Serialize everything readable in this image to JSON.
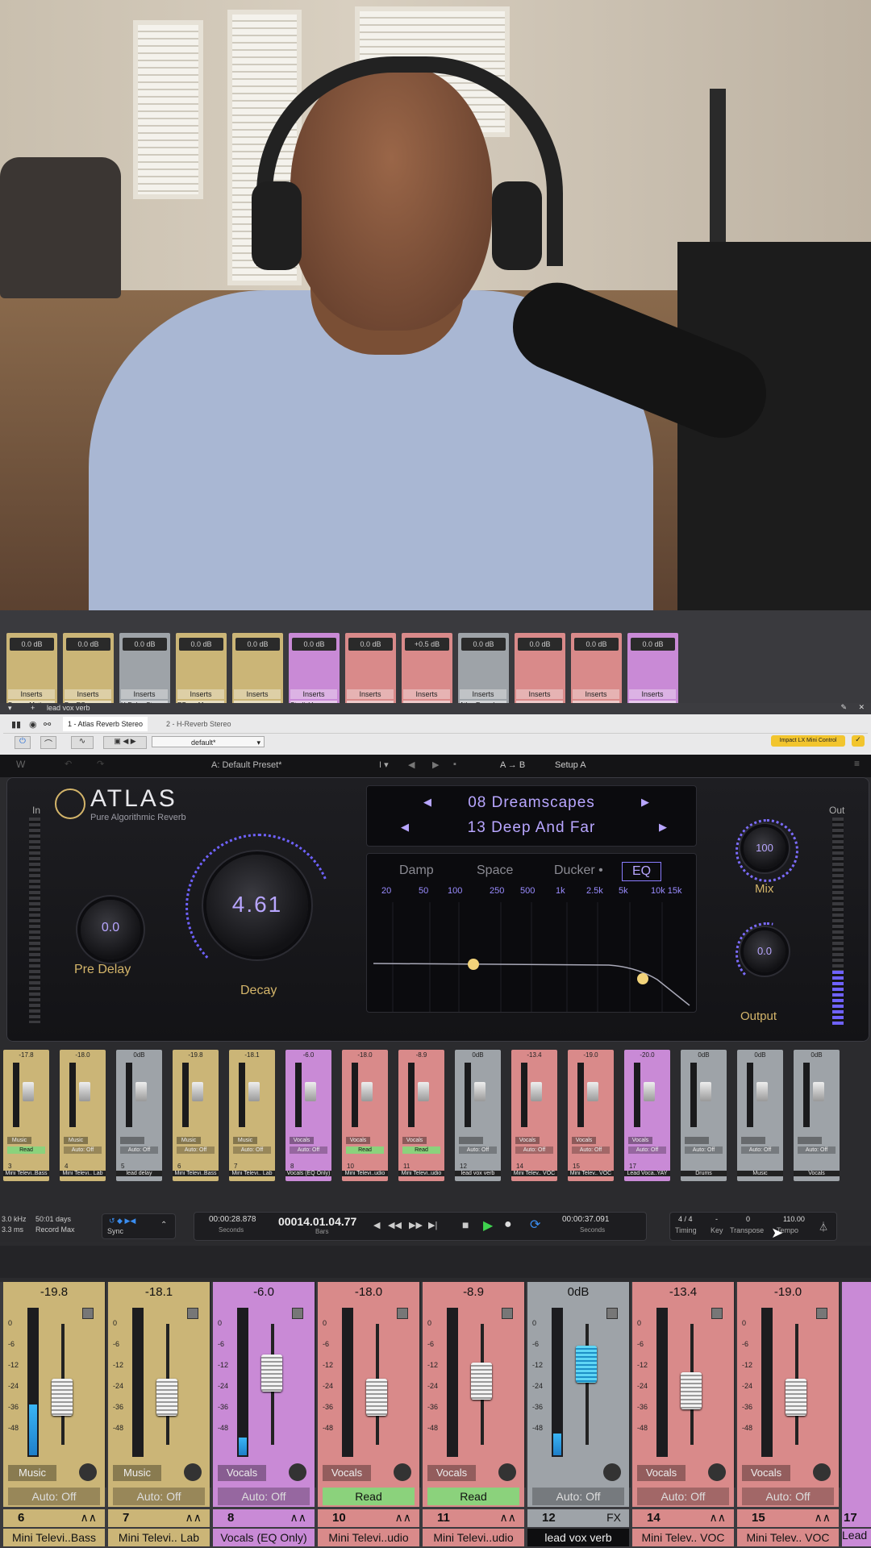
{
  "colors": {
    "music": "#cbb577",
    "vocals": "#c98ad6",
    "mini": "#d98a8a",
    "gray": "#9ea3a8",
    "accent": "#8a7cff"
  },
  "top_channels": [
    {
      "db": "0.0 dB",
      "ins": "Inserts",
      "plugin": "Brauer Moti..",
      "color": "#cbb577"
    },
    {
      "db": "0.0 dB",
      "ins": "Inserts",
      "plugin": "Pro EQ",
      "color": "#cbb577"
    },
    {
      "db": "0.0 dB",
      "ins": "Inserts",
      "plugin": "H-Delay Ster..",
      "color": "#9ea3a8"
    },
    {
      "db": "0.0 dB",
      "ins": "Inserts",
      "plugin": "RBass Mono",
      "color": "#cbb577"
    },
    {
      "db": "0.0 dB",
      "ins": "Inserts",
      "plugin": "",
      "color": "#cbb577"
    },
    {
      "db": "0.0 dB",
      "ins": "Inserts",
      "plugin": "StudioVerse..",
      "color": "#c98ad6"
    },
    {
      "db": "0.0 dB",
      "ins": "Inserts",
      "plugin": "",
      "color": "#d98a8a"
    },
    {
      "db": "+0.5 dB",
      "ins": "Inserts",
      "plugin": "",
      "color": "#d98a8a"
    },
    {
      "db": "0.0 dB",
      "ins": "Inserts",
      "plugin": "Atlas Reverb",
      "color": "#9ea3a8"
    },
    {
      "db": "0.0 dB",
      "ins": "Inserts",
      "plugin": "",
      "color": "#d98a8a"
    },
    {
      "db": "0.0 dB",
      "ins": "Inserts",
      "plugin": "",
      "color": "#d98a8a"
    },
    {
      "db": "0.0 dB",
      "ins": "Inserts",
      "plugin": "",
      "color": "#c98ad6"
    }
  ],
  "plugin_window": {
    "track": "lead vox verb",
    "slot1": "1 - Atlas Reverb Stereo",
    "slot2": "2 - H-Reverb Stereo",
    "preset_dropdown": "default*",
    "controller": "Impact LX Mini Control",
    "preset_name": "A: Default Preset*",
    "ab": "A → B",
    "setup": "Setup A"
  },
  "atlas": {
    "brand": "ATLAS",
    "subtitle": "Pure Algorithmic Reverb",
    "in_label": "In",
    "out_label": "Out",
    "category": "08 Dreamscapes",
    "preset": "13 Deep And Far",
    "tabs": [
      "Damp",
      "Space",
      "Ducker •",
      "EQ"
    ],
    "freqs": [
      "20",
      "50",
      "100",
      "250",
      "500",
      "1k",
      "2.5k",
      "5k",
      "10k 15k"
    ],
    "pre_delay_value": "0.0",
    "pre_delay_label": "Pre Delay",
    "decay_value": "4.61",
    "decay_label": "Decay",
    "mix_value": "100",
    "mix_label": "Mix",
    "output_value": "0.0",
    "output_label": "Output"
  },
  "small_mixer": [
    {
      "v": "-17.8",
      "tag": "Music",
      "auto": "Read",
      "num": "3",
      "name": "Mini Televi..Bass",
      "color": "#cbb577"
    },
    {
      "v": "-18.0",
      "tag": "Music",
      "auto": "Auto: Off",
      "num": "4",
      "name": "Mini Televi.. Lab",
      "color": "#cbb577"
    },
    {
      "v": "0dB",
      "tag": "",
      "auto": "Auto: Off",
      "num": "5",
      "name": "lead delay",
      "color": "#9ea3a8"
    },
    {
      "v": "-19.8",
      "tag": "Music",
      "auto": "Auto: Off",
      "num": "6",
      "name": "Mini Televi..Bass",
      "color": "#cbb577"
    },
    {
      "v": "-18.1",
      "tag": "Music",
      "auto": "Auto: Off",
      "num": "7",
      "name": "Mini Televi.. Lab",
      "color": "#cbb577"
    },
    {
      "v": "-6.0",
      "tag": "Vocals",
      "auto": "Auto: Off",
      "num": "8",
      "name": "Vocals (EQ Only)",
      "color": "#c98ad6"
    },
    {
      "v": "-18.0",
      "tag": "Vocals",
      "auto": "Read",
      "num": "10",
      "name": "Mini Televi..udio",
      "color": "#d98a8a"
    },
    {
      "v": "-8.9",
      "tag": "Vocals",
      "auto": "Read",
      "num": "11",
      "name": "Mini Televi..udio",
      "color": "#d98a8a"
    },
    {
      "v": "0dB",
      "tag": "",
      "auto": "Auto: Off",
      "num": "12",
      "name": "lead vox verb",
      "color": "#9ea3a8"
    },
    {
      "v": "-13.4",
      "tag": "Vocals",
      "auto": "Auto: Off",
      "num": "14",
      "name": "Mini Telev.. VOC",
      "color": "#d98a8a"
    },
    {
      "v": "-19.0",
      "tag": "Vocals",
      "auto": "Auto: Off",
      "num": "15",
      "name": "Mini Telev.. VOC",
      "color": "#d98a8a"
    },
    {
      "v": "-20.0",
      "tag": "Vocals",
      "auto": "Auto: Off",
      "num": "17",
      "name": "Lead Voca..YAY",
      "color": "#c98ad6"
    },
    {
      "v": "0dB",
      "tag": "",
      "auto": "Auto: Off",
      "num": "",
      "name": "Drums",
      "color": "#9ea3a8"
    },
    {
      "v": "0dB",
      "tag": "",
      "auto": "Auto: Off",
      "num": "",
      "name": "Music",
      "color": "#9ea3a8"
    },
    {
      "v": "0dB",
      "tag": "",
      "auto": "Auto: Off",
      "num": "",
      "name": "Vocals",
      "color": "#9ea3a8"
    }
  ],
  "transport": {
    "sample_rate": "3.0 kHz",
    "latency": "3.3 ms",
    "record_days": "50:01 days",
    "record_max": "Record Max",
    "sync": "Sync",
    "time1": "00:00:28.878",
    "time1_unit": "Seconds",
    "bars": "00014.01.04.77",
    "bars_unit": "Bars",
    "time2": "00:00:37.091",
    "time2_unit": "Seconds",
    "timing_val": "4 / 4",
    "timing": "Timing",
    "key_val": "-",
    "key": "Key",
    "transpose_val": "0",
    "transpose": "Transpose",
    "tempo_val": "110.00",
    "tempo": "Tempo"
  },
  "large_mixer": [
    {
      "val": "-19.8",
      "tag": "Music",
      "auto": "Auto: Off",
      "num": "6",
      "name": "Mini Televi..Bass",
      "color": "#cbb577",
      "fader": 0.55,
      "meter": 0.35
    },
    {
      "val": "-18.1",
      "tag": "Music",
      "auto": "Auto: Off",
      "num": "7",
      "name": "Mini Televi.. Lab",
      "color": "#cbb577",
      "fader": 0.55,
      "meter": 0.0
    },
    {
      "val": "-6.0",
      "tag": "Vocals",
      "auto": "Auto: Off",
      "num": "8",
      "name": "Vocals (EQ Only)",
      "color": "#c98ad6",
      "fader": 0.75,
      "meter": 0.12
    },
    {
      "val": "-18.0",
      "tag": "Vocals",
      "auto": "Read",
      "num": "10",
      "name": "Mini Televi..udio",
      "color": "#d98a8a",
      "fader": 0.55,
      "meter": 0.0
    },
    {
      "val": "-8.9",
      "tag": "Vocals",
      "auto": "Read",
      "num": "11",
      "name": "Mini Televi..udio",
      "color": "#d98a8a",
      "fader": 0.68,
      "meter": 0.0
    },
    {
      "val": "0dB",
      "tag": "",
      "auto": "Auto: Off",
      "num": "12",
      "name": "lead vox verb",
      "color": "#9ea3a8",
      "fader": 0.82,
      "meter": 0.15
    },
    {
      "val": "-13.4",
      "tag": "Vocals",
      "auto": "Auto: Off",
      "num": "14",
      "name": "Mini Telev.. VOC",
      "color": "#d98a8a",
      "fader": 0.6,
      "meter": 0.0
    },
    {
      "val": "-19.0",
      "tag": "Vocals",
      "auto": "Auto: Off",
      "num": "15",
      "name": "Mini Telev.. VOC",
      "color": "#d98a8a",
      "fader": 0.55,
      "meter": 0.0
    }
  ],
  "large_mixer_partial": {
    "num": "17",
    "name": "Lead"
  },
  "scale_marks": [
    "0",
    "-6",
    "-12",
    "-24",
    "-36",
    "-48"
  ]
}
